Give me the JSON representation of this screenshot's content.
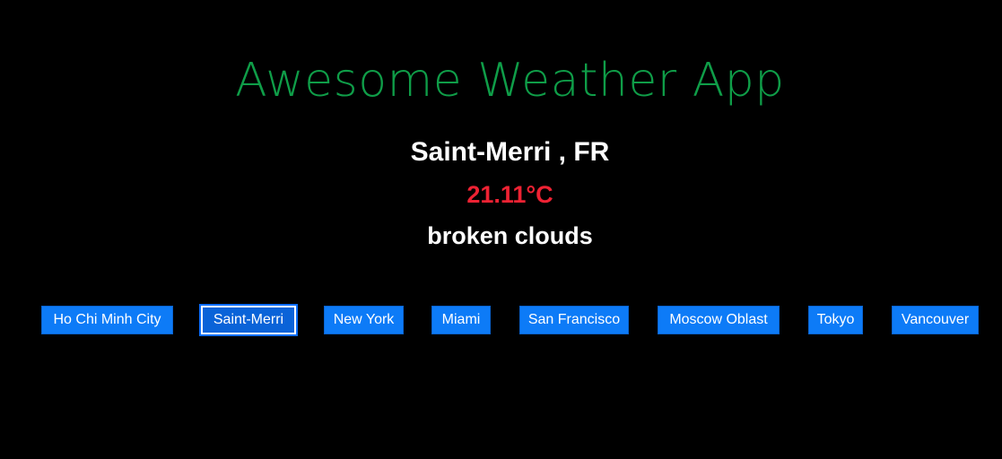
{
  "header": {
    "title": "Awesome Weather App"
  },
  "weather": {
    "location": "Saint-Merri , FR",
    "temperature": "21.11°C",
    "description": "broken clouds"
  },
  "cities": [
    {
      "label": "Ho Chi Minh City",
      "selected": false
    },
    {
      "label": "Saint-Merri",
      "selected": true
    },
    {
      "label": "New York",
      "selected": false
    },
    {
      "label": "Miami",
      "selected": false
    },
    {
      "label": "San Francisco",
      "selected": false
    },
    {
      "label": "Moscow Oblast",
      "selected": false
    },
    {
      "label": "Tokyo",
      "selected": false
    },
    {
      "label": "Vancouver",
      "selected": false
    }
  ],
  "colors": {
    "background": "#000000",
    "title": "#0f9d48",
    "temperature": "#ee2233",
    "button": "#0d7bf7",
    "text": "#ffffff"
  }
}
